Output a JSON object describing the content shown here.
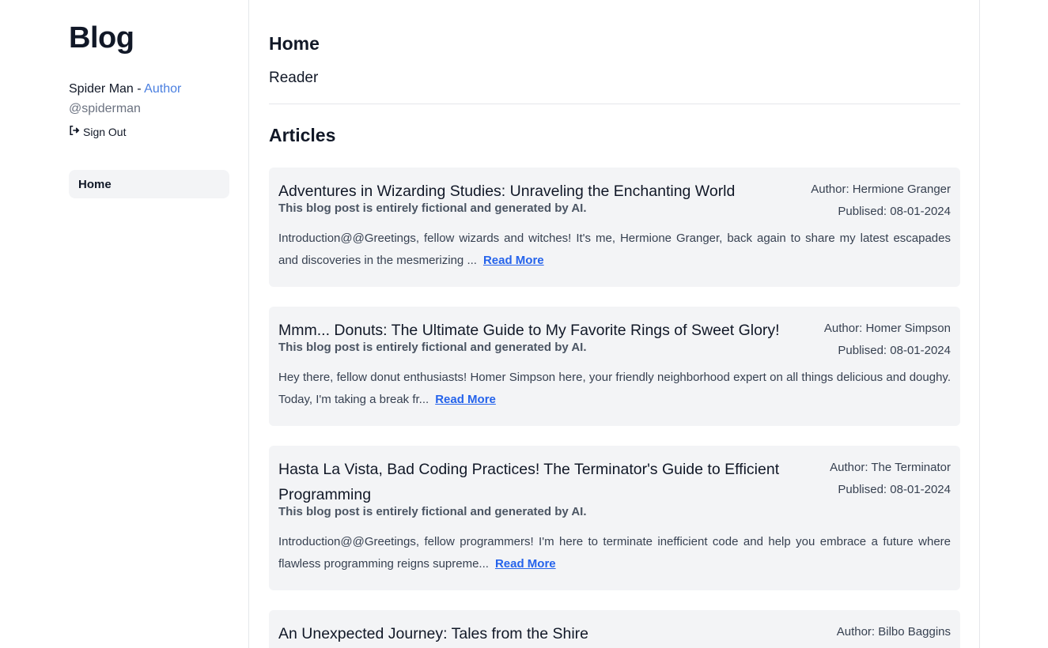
{
  "sidebar": {
    "blog_title": "Blog",
    "user": {
      "name": "Spider Man",
      "separator": " - ",
      "role": "Author",
      "handle": "@spiderman"
    },
    "sign_out_label": "Sign Out",
    "nav": [
      {
        "label": "Home"
      }
    ]
  },
  "main": {
    "title": "Home",
    "subtitle": "Reader",
    "section_title": "Articles",
    "read_more_label": "Read More",
    "articles": [
      {
        "title": "Adventures in Wizarding Studies: Unraveling the Enchanting World",
        "author": "Author: Hermione Granger",
        "published": "Publised: 08-01-2024",
        "disclaimer": "This blog post is entirely fictional and generated by AI.",
        "excerpt": "Introduction@@Greetings, fellow wizards and witches! It's me, Hermione Granger, back again to share my latest escapades and discoveries in the mesmerizing ..."
      },
      {
        "title": "Mmm... Donuts: The Ultimate Guide to My Favorite Rings of Sweet Glory!",
        "author": "Author: Homer Simpson",
        "published": "Publised: 08-01-2024",
        "disclaimer": "This blog post is entirely fictional and generated by AI.",
        "excerpt": "Hey there, fellow donut enthusiasts! Homer Simpson here, your friendly neighborhood expert on all things delicious and doughy. Today, I'm taking a break fr..."
      },
      {
        "title": "Hasta La Vista, Bad Coding Practices! The Terminator's Guide to Efficient Programming",
        "author": "Author: The Terminator",
        "published": "Publised: 08-01-2024",
        "disclaimer": "This blog post is entirely fictional and generated by AI.",
        "excerpt": "Introduction@@Greetings, fellow programmers! I'm here to terminate inefficient code and help you embrace a future where flawless programming reigns supreme..."
      },
      {
        "title": "An Unexpected Journey: Tales from the Shire",
        "author": "Author: Bilbo Baggins"
      }
    ]
  },
  "colors": {
    "accent": "#4a7fe0",
    "link": "#2563eb",
    "card_bg": "#f3f4f6"
  },
  "icons": {
    "sign_out": "sign-out-icon"
  }
}
